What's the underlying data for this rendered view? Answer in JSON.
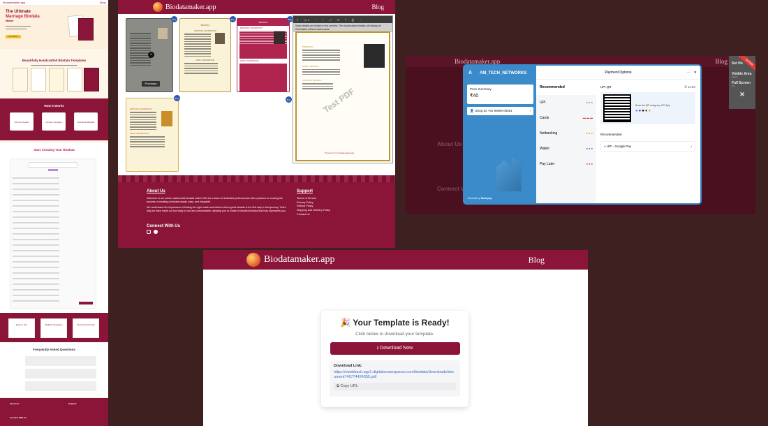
{
  "left_page": {
    "logo_text": "Biodatamaker.app",
    "nav_blog": "Blog",
    "hero_title_1": "The Ultimate",
    "hero_title_2": "Marriage Biodata",
    "hero_title_3": "Maker",
    "hero_cta": "Get Started",
    "templates_heading": "Beautifully Handcrafted Biodata Templates",
    "how_heading": "How It Works",
    "steps": [
      "Fill your Details",
      "Choose Template",
      "Download Biodata"
    ],
    "form_heading": "Start Creating Your Biodata",
    "features": [
      "Easy to Use",
      "Multiple Templates",
      "Download Instantly"
    ],
    "faq_heading": "Frequently Asked Questions",
    "footer_about": "About Us",
    "footer_support": "Support",
    "footer_connect": "Connect With Us"
  },
  "site": {
    "logo_text": "Biodatamaker.app",
    "nav_blog": "Blog",
    "purchase_label": "Purchase",
    "badge_labels": [
      "Buy",
      "Buy",
      "Buy",
      "Buy",
      "Buy"
    ],
    "card_titles": [
      "BIODATA",
      "BIODATA"
    ],
    "personal_info": "PERSONAL INFORMATION",
    "family_info": "FAMILY INFORMATION",
    "pdf_notice": "Some details are hidden in the preview. The downloaded biodata will display all information without watermarks.",
    "watermark": "Test PDF",
    "pdf_footer": "Preview from biodatamaker.app",
    "pdf_labels": {
      "personal": "PERSONAL",
      "family": "FAMILY DETAILS",
      "contact": "CONTACT DETAILS"
    },
    "about_title": "About Us",
    "about_p1": "Welcome to our online matrimonial biodata maker! We are a team of dedicated professionals with a passion for making the process of creating a biodata simple, easy, and enjoyable.",
    "about_p2": "We understand the importance of finding the right match and believe that a great biodata is the first step in that journey. That's why we have made our tool easy to use and customizable, allowing you to create a beautiful biodata that truly represents you.",
    "support_title": "Support",
    "support_links": [
      "Terms of Service",
      "Privacy Policy",
      "Refund Policy",
      "Shipping and Delivery Policy",
      "Contact Us"
    ],
    "connect_title": "Connect With Us"
  },
  "payment": {
    "bg_logo": "Biodatamaker.app",
    "bg_blog": "Blog",
    "bg_about": "About Us",
    "bg_connect": "Connect W",
    "side_menu": [
      "Set Ho",
      "Visible Area",
      "Full Screen"
    ],
    "side_keys": [
      "",
      "space",
      "fn f"
    ],
    "sample_badge": "Sample",
    "merchant_initial": "A",
    "merchant_name": "AM_TECH_NETWORKS",
    "price_summary_label": "Price Summary",
    "price": "₹40",
    "using_label": "Using as +91 90690 06661",
    "secured_by": "Secured by",
    "razorpay": "Razorpay",
    "panel_title": "Payment Options",
    "methods": [
      "Recommended",
      "UPI",
      "Cards",
      "Netbanking",
      "Wallet",
      "Pay Later"
    ],
    "upi_qr_label": "UPI QR",
    "timer": "11:50",
    "scan_text": "Scan the QR using any UPI App",
    "recommended_label": "Recommended",
    "gpay_label": "UPI - Google Pay",
    "colors": {
      "header": "#3b8ac9",
      "accent": "#2e6fbd"
    }
  },
  "ready": {
    "logo_text": "Biodatamaker.app",
    "nav_blog": "Blog",
    "emoji": "🎉",
    "title": "Your Template is Ready!",
    "subtitle": "Click below to download your template.",
    "download_btn": "Download Now",
    "link_label": "Download Link:",
    "link_url": "https://cwebback.sgp1.digitaloceanspaces.com/biodata/downloads/document746774424355.pdf",
    "copy_btn": "Copy URL",
    "colors": {
      "brand": "#8b1538"
    }
  }
}
